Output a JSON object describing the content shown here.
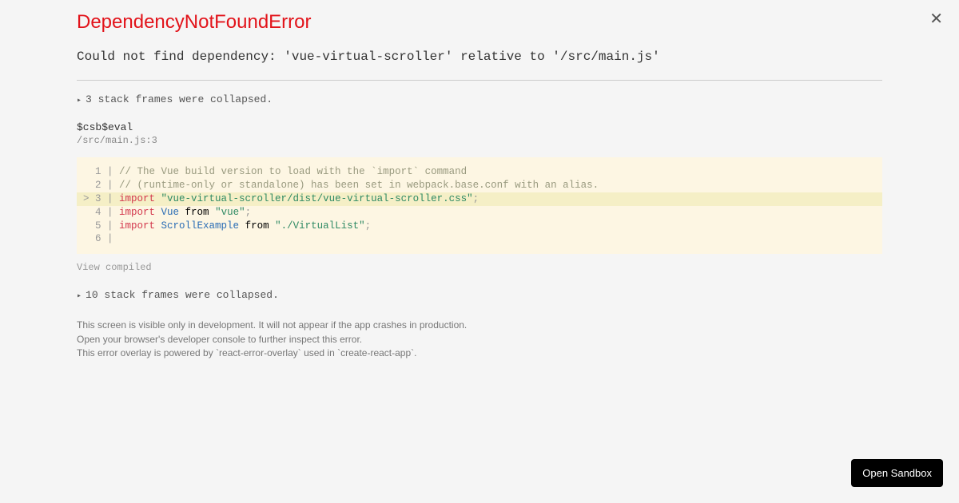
{
  "title": "DependencyNotFoundError",
  "error_message": "Could not find dependency: 'vue-virtual-scroller' relative to '/src/main.js'",
  "collapsed_top": "3 stack frames were collapsed.",
  "frame_title": "$csb$eval",
  "frame_location": "/src/main.js:3",
  "code": {
    "line1_gutter": "  1 | ",
    "line1_comment": "// The Vue build version to load with the `import` command",
    "line2_gutter": "  2 | ",
    "line2_comment": "// (runtime-only or standalone) has been set in webpack.base.conf with an alias.",
    "line3_gutter": "> 3 | ",
    "line3_kw": "import",
    "line3_str": " \"vue-virtual-scroller/dist/vue-virtual-scroller.css\"",
    "line3_punct": ";",
    "line4_gutter": "  4 | ",
    "line4_kw": "import",
    "line4_ident": " Vue",
    "line4_from": " from ",
    "line4_str": "\"vue\"",
    "line4_punct": ";",
    "line5_gutter": "  5 | ",
    "line5_kw": "import",
    "line5_ident": " ScrollExample",
    "line5_from": " from ",
    "line5_str": "\"./VirtualList\"",
    "line5_punct": ";",
    "line6_gutter": "  6 | "
  },
  "view_compiled": "View compiled",
  "collapsed_bottom": "10 stack frames were collapsed.",
  "notes": {
    "line1": "This screen is visible only in development. It will not appear if the app crashes in production.",
    "line2": "Open your browser's developer console to further inspect this error.",
    "line3": "This error overlay is powered by `react-error-overlay` used in `create-react-app`."
  },
  "open_sandbox": "Open Sandbox"
}
